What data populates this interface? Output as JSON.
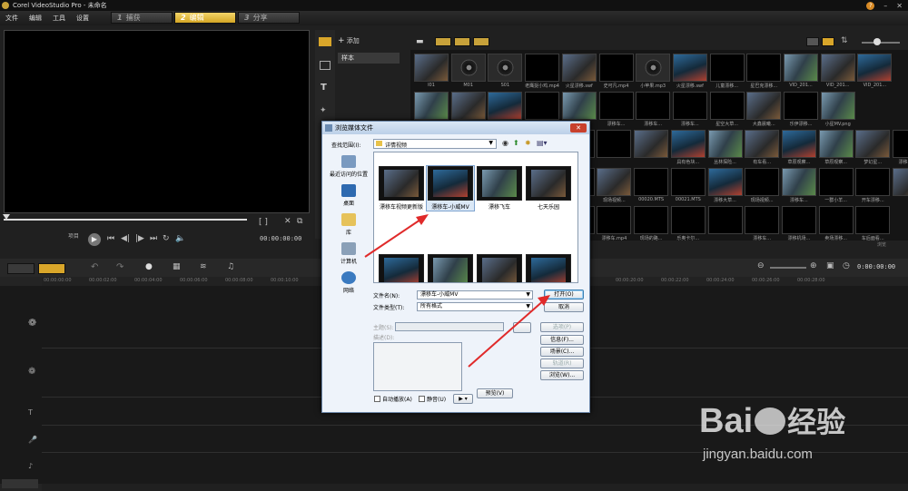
{
  "app": {
    "title": "Corel VideoStudio Pro - 未命名",
    "menu": [
      "文件",
      "编辑",
      "工具",
      "设置"
    ],
    "steps": [
      {
        "num": "1",
        "label": "捕获"
      },
      {
        "num": "2",
        "label": "编辑"
      },
      {
        "num": "3",
        "label": "分享"
      }
    ]
  },
  "preview": {
    "project_label": "项目",
    "timecode": "00:00:00:00"
  },
  "library": {
    "add_label": "添加",
    "folder": "样本",
    "thumbs": [
      {
        "label": "I01",
        "kind": "ph"
      },
      {
        "label": "M01",
        "kind": "audio"
      },
      {
        "label": "S01",
        "kind": "audio"
      },
      {
        "label": "老鹰捉小鸡.mp4",
        "kind": ""
      },
      {
        "label": "火星漂移.swf",
        "kind": "ph"
      },
      {
        "label": "史可凡.mp4",
        "kind": ""
      },
      {
        "label": "小苹果.mp3",
        "kind": "audio"
      },
      {
        "label": "火星漂移.swf",
        "kind": "ph2"
      },
      {
        "label": "儿童漂移...",
        "kind": ""
      },
      {
        "label": "星巴克漂移...",
        "kind": ""
      },
      {
        "label": "VID_201...",
        "kind": "ph3"
      },
      {
        "label": "VID_201...",
        "kind": "ph"
      },
      {
        "label": "VID_201...",
        "kind": "ph2"
      },
      {
        "label": "",
        "kind": "ph3"
      },
      {
        "label": "",
        "kind": "ph"
      },
      {
        "label": "",
        "kind": "ph2"
      },
      {
        "label": "",
        "kind": ""
      },
      {
        "label": "",
        "kind": "ph3"
      },
      {
        "label": "漂移车...",
        "kind": ""
      },
      {
        "label": "漂移车...",
        "kind": ""
      },
      {
        "label": "漂移车...",
        "kind": ""
      },
      {
        "label": "星空大草...",
        "kind": ""
      },
      {
        "label": "大鑫晨曦...",
        "kind": "ph"
      },
      {
        "label": "乐伊漂移...",
        "kind": ""
      },
      {
        "label": "小星MV.png",
        "kind": "ph3"
      },
      {
        "label": "",
        "kind": ""
      },
      {
        "label": "",
        "kind": ""
      },
      {
        "label": "",
        "kind": ""
      },
      {
        "label": "",
        "kind": "ph"
      },
      {
        "label": "具有色块...",
        "kind": "ph2"
      },
      {
        "label": "丛林探险...",
        "kind": "ph3"
      },
      {
        "label": "有车看...",
        "kind": "ph"
      },
      {
        "label": "草原观察...",
        "kind": "ph2"
      },
      {
        "label": "草原观察...",
        "kind": "ph3"
      },
      {
        "label": "梦幻星...",
        "kind": "ph"
      },
      {
        "label": "漂移车.swf",
        "kind": ""
      },
      {
        "label": "梦幻的星...",
        "kind": ""
      },
      {
        "label": "",
        "kind": ""
      },
      {
        "label": "漂移车...",
        "kind": ""
      },
      {
        "label": "现场视频...",
        "kind": "ph"
      },
      {
        "label": "00020.MTS",
        "kind": ""
      },
      {
        "label": "00021.MTS",
        "kind": ""
      },
      {
        "label": "漂移大草...",
        "kind": "ph2"
      },
      {
        "label": "现场视频...",
        "kind": ""
      },
      {
        "label": "漂移车...",
        "kind": "ph3"
      },
      {
        "label": "一群小羊...",
        "kind": ""
      },
      {
        "label": "开车漂移...",
        "kind": ""
      },
      {
        "label": "",
        "kind": "ph"
      },
      {
        "label": "升降指南...",
        "kind": "ph2"
      },
      {
        "label": "快乐节.mp4",
        "kind": ""
      },
      {
        "label": "漂移车.mp4",
        "kind": ""
      },
      {
        "label": "现场的路...",
        "kind": ""
      },
      {
        "label": "乐奥卡尔...",
        "kind": ""
      },
      {
        "label": "",
        "kind": ""
      },
      {
        "label": "漂移车...",
        "kind": ""
      },
      {
        "label": "漂移机场...",
        "kind": ""
      },
      {
        "label": "卖场漂移...",
        "kind": ""
      },
      {
        "label": "车后面看...",
        "kind": ""
      }
    ],
    "tab_hint": "浏览"
  },
  "timeline": {
    "timecode": "0:00:00:00",
    "ruler": [
      "00:00:00:00",
      "00:00:02:00",
      "00:00:04:00",
      "00:00:06:00",
      "00:00:08:00",
      "00:00:10:00",
      "00:00:20:00",
      "00:00:22:00",
      "00:00:24:00",
      "00:00:26:00",
      "00:00:28:00"
    ]
  },
  "dialog": {
    "title": "浏览媒体文件",
    "lookin_label": "查找范围(I):",
    "lookin_value": "详情视频",
    "places": [
      "最近访问的位置",
      "桌面",
      "库",
      "计算机",
      "网络"
    ],
    "files": [
      {
        "name": "漂移车视频更新版",
        "kind": "ph"
      },
      {
        "name": "漂移车-小威MV",
        "kind": "ph2"
      },
      {
        "name": "漂移飞车",
        "kind": "ph3"
      },
      {
        "name": "七天乐园",
        "kind": "ph"
      },
      {
        "name": "",
        "kind": "ph2"
      },
      {
        "name": "",
        "kind": "ph3"
      },
      {
        "name": "",
        "kind": "ph"
      },
      {
        "name": "",
        "kind": "ph2"
      }
    ],
    "filename_label": "文件名(N):",
    "filename_value": "漂移车-小威MV",
    "filetype_label": "文件类型(T):",
    "filetype_value": "所有格式",
    "subject_label": "主题(S):",
    "desc_label": "描述(D):",
    "open": "打开(O)",
    "cancel": "取消",
    "options": "选项(P)",
    "info": "信息(F)...",
    "scene": "场景(C)...",
    "track": "轨道(R)",
    "browse": "浏览(W)...",
    "autoplay": "自动播放(A)",
    "mute": "静音(U)",
    "preview": "预览(V)"
  },
  "watermark": {
    "brand": "Bai",
    "brand2": "经验",
    "url": "jingyan.baidu.com"
  },
  "colors": {
    "accent": "#d9a62a",
    "arrow": "#e02a2a"
  }
}
